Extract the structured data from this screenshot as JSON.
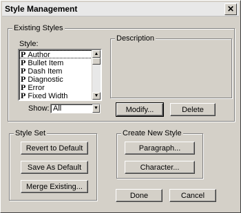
{
  "window": {
    "title": "Style Management",
    "close_glyph": "✕"
  },
  "existing": {
    "group_label": "Existing Styles",
    "style_label": "Style:",
    "items": [
      {
        "icon": "P",
        "label": "Author"
      },
      {
        "icon": "P",
        "label": "Bullet Item"
      },
      {
        "icon": "P",
        "label": "Dash Item"
      },
      {
        "icon": "P",
        "label": "Diagnostic"
      },
      {
        "icon": "P",
        "label": "Error"
      },
      {
        "icon": "P",
        "label": "Fixed Width"
      }
    ],
    "show_label": "Show:",
    "show_value": "All",
    "description_label": "Description",
    "modify_label": "Modify...",
    "delete_label": "Delete"
  },
  "style_set": {
    "group_label": "Style Set",
    "revert_label": "Revert to Default",
    "save_label": "Save As Default",
    "merge_label": "Merge Existing..."
  },
  "create": {
    "group_label": "Create New Style",
    "paragraph_label": "Paragraph...",
    "character_label": "Character..."
  },
  "footer": {
    "done_label": "Done",
    "cancel_label": "Cancel"
  }
}
